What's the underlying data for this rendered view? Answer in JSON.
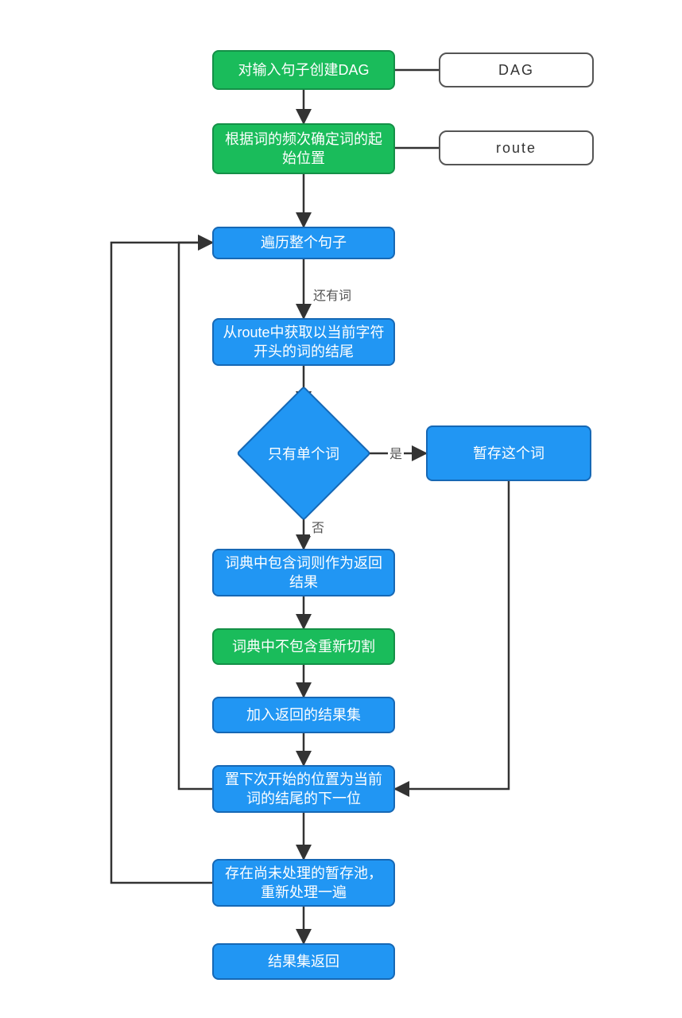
{
  "nodes": {
    "n1": "对输入句子创建DAG",
    "a1": "DAG",
    "n2": "根据词的频次确定词的起始位置",
    "a2": "route",
    "n3": "遍历整个句子",
    "n4": "从route中获取以当前字符开头的词的结尾",
    "d1": "只有单个词",
    "n5": "暂存这个词",
    "n6": "词典中包含词则作为返回结果",
    "n7": "词典中不包含重新切割",
    "n8": "加入返回的结果集",
    "n9": "置下次开始的位置为当前词的结尾的下一位",
    "n10": "存在尚未处理的暂存池，重新处理一遍",
    "n11": "结果集返回"
  },
  "edgeLabels": {
    "e_n3_n4": "还有词",
    "e_d1_yes": "是",
    "e_d1_no": "否"
  },
  "chart_data": {
    "type": "flowchart",
    "nodes": [
      {
        "id": "n1",
        "kind": "process-start",
        "text": "对输入句子创建DAG"
      },
      {
        "id": "a1",
        "kind": "annotation",
        "text": "DAG"
      },
      {
        "id": "n2",
        "kind": "process-start",
        "text": "根据词的频次确定词的起始位置"
      },
      {
        "id": "a2",
        "kind": "annotation",
        "text": "route"
      },
      {
        "id": "n3",
        "kind": "process",
        "text": "遍历整个句子"
      },
      {
        "id": "n4",
        "kind": "process",
        "text": "从route中获取以当前字符开头的词的结尾"
      },
      {
        "id": "d1",
        "kind": "decision",
        "text": "只有单个词"
      },
      {
        "id": "n5",
        "kind": "process",
        "text": "暂存这个词"
      },
      {
        "id": "n6",
        "kind": "process",
        "text": "词典中包含词则作为返回结果"
      },
      {
        "id": "n7",
        "kind": "process-alt",
        "text": "词典中不包含重新切割"
      },
      {
        "id": "n8",
        "kind": "process",
        "text": "加入返回的结果集"
      },
      {
        "id": "n9",
        "kind": "process",
        "text": "置下次开始的位置为当前词的结尾的下一位"
      },
      {
        "id": "n10",
        "kind": "process",
        "text": "存在尚未处理的暂存池，重新处理一遍"
      },
      {
        "id": "n11",
        "kind": "process",
        "text": "结果集返回"
      }
    ],
    "edges": [
      {
        "from": "n1",
        "to": "a1",
        "label": ""
      },
      {
        "from": "n1",
        "to": "n2",
        "label": ""
      },
      {
        "from": "n2",
        "to": "a2",
        "label": ""
      },
      {
        "from": "n2",
        "to": "n3",
        "label": ""
      },
      {
        "from": "n3",
        "to": "n4",
        "label": "还有词"
      },
      {
        "from": "n4",
        "to": "d1",
        "label": ""
      },
      {
        "from": "d1",
        "to": "n5",
        "label": "是"
      },
      {
        "from": "d1",
        "to": "n6",
        "label": "否"
      },
      {
        "from": "n6",
        "to": "n7",
        "label": ""
      },
      {
        "from": "n7",
        "to": "n8",
        "label": ""
      },
      {
        "from": "n8",
        "to": "n9",
        "label": ""
      },
      {
        "from": "n5",
        "to": "n9",
        "label": ""
      },
      {
        "from": "n9",
        "to": "n3",
        "label": "",
        "note": "loop-back-inner"
      },
      {
        "from": "n9",
        "to": "n10",
        "label": ""
      },
      {
        "from": "n10",
        "to": "n3",
        "label": "",
        "note": "loop-back-outer"
      },
      {
        "from": "n10",
        "to": "n11",
        "label": ""
      }
    ]
  }
}
